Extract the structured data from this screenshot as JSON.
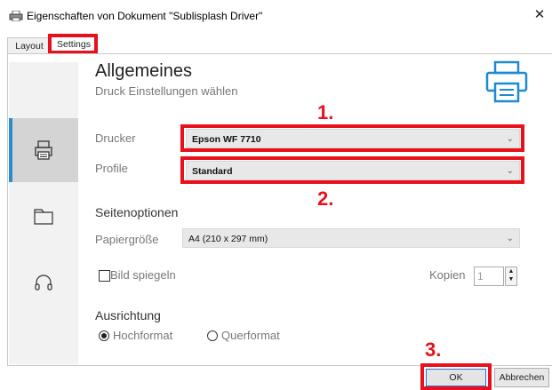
{
  "window": {
    "title": "Eigenschaften von Dokument \"Sublisplash Driver\"",
    "close_symbol": "✕"
  },
  "tabs": [
    {
      "label": "Layout"
    },
    {
      "label": "Settings"
    }
  ],
  "header": {
    "title": "Allgemeines",
    "subtitle": "Druck Einstellungen wählen"
  },
  "general": {
    "printer_label": "Drucker",
    "printer_value": "Epson WF 7710",
    "profile_label": "Profile",
    "profile_value": "Standard"
  },
  "page_options": {
    "section_title": "Seitenoptionen",
    "paper_label": "Papiergröße",
    "paper_value": "A4 (210 x 297 mm)",
    "mirror_label": "Bild spiegeln",
    "mirror_checked": false,
    "copies_label": "Kopien",
    "copies_value": "1"
  },
  "orientation": {
    "section_title": "Ausrichtung",
    "portrait_label": "Hochformat",
    "landscape_label": "Querformat",
    "selected": "portrait"
  },
  "annotations": {
    "step1": "1.",
    "step2": "2.",
    "step3": "3.",
    "highlight_color": "#e8101a"
  },
  "buttons": {
    "ok": "OK",
    "cancel": "Abbrechen"
  },
  "sidebar": {
    "items": [
      "printer-icon",
      "document-icon",
      "headset-icon"
    ],
    "active": "printer-icon",
    "accent_color": "#2a8ad4"
  }
}
